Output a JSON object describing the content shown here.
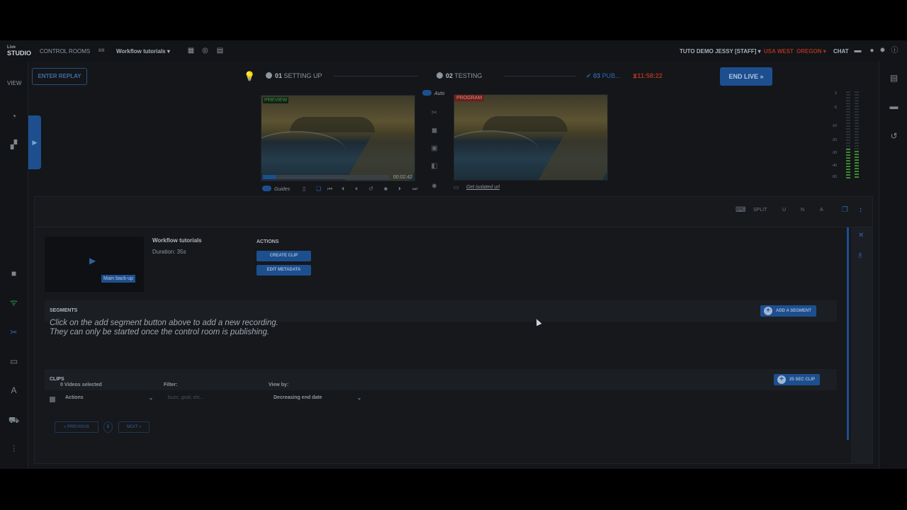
{
  "colors": {
    "accent": "#1d4f8f",
    "live_red": "#a8321f",
    "preview_green": "#2f9a4a"
  },
  "topbar": {
    "logo_top": "Live",
    "logo_main": "STUDIO",
    "control_rooms": "CONTROL ROOMS",
    "room_badge": "8/8",
    "room_name": "Workflow tutorials",
    "user": "TUTO DEMO JESSY [STAFF]",
    "region": "USA WEST",
    "location": "OREGON",
    "chat": "CHAT"
  },
  "leftrail": {
    "view_label": "VIEW"
  },
  "stages": {
    "enter_replay": "ENTER REPLAY",
    "step1_num": "01",
    "step1_label": "SETTING UP",
    "step2_num": "02",
    "step2_label": "TESTING",
    "step3_num": "03",
    "step3_label": "PUB...",
    "timer": "11:58:22",
    "end_live": "END LIVE"
  },
  "preview": {
    "tag": "PREVIEW",
    "time": "00:02:42",
    "progress": 0.1
  },
  "program": {
    "tag": "PROGRAM"
  },
  "auto_label": "Auto",
  "guides_label": "Guides",
  "isolated_link": "Get isolated url",
  "meter_labels": [
    "0",
    "-5",
    "-10",
    "-20",
    "-30",
    "-40",
    "-50"
  ],
  "meter_levels": [
    0.35,
    0.32
  ],
  "panel": {
    "head_icons": [
      "SPLIT",
      "U",
      "N",
      "A"
    ],
    "clip_title": "Workflow tutorials",
    "duration": "Duration: 35s",
    "thumb_badge": "Main back-up",
    "actions_label": "ACTIONS",
    "create_clip": "CREATE CLIP",
    "edit_metadata": "EDIT METADATA",
    "segments_title": "SEGMENTS",
    "add_segment": "ADD A SEGMENT",
    "empty_line1": "Click on the add segment button above to add a new recording.",
    "empty_line2": "They can only be started once the control room is publishing.",
    "clips_title": "CLIPS",
    "sec_clip": "25 SEC CLIP",
    "videos_selected": "0 Videos selected",
    "filter_label": "Filter:",
    "view_by_label": "View by:",
    "actions_select": "Actions",
    "filter_placeholder": "buzz, goal, etc...",
    "view_by_value": "Decreasing end date",
    "prev": "« PREVIOUS",
    "page": "1",
    "next": "NEXT »"
  }
}
